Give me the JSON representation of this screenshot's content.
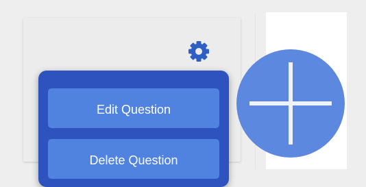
{
  "question_card": {
    "settings_icon": "gear-icon"
  },
  "context_menu": {
    "items": [
      {
        "label": "Edit Question"
      },
      {
        "label": "Delete Question"
      }
    ]
  },
  "fab": {
    "icon": "plus-icon"
  },
  "colors": {
    "menu_background": "#2e53bf",
    "menu_item": "#5082e0",
    "fab": "#5d88e0",
    "gear": "#2f5fc4"
  }
}
